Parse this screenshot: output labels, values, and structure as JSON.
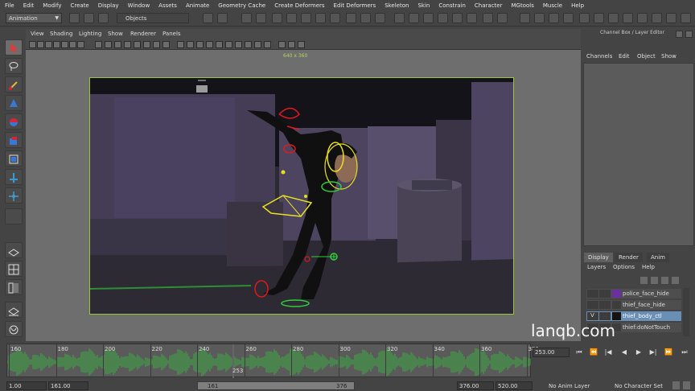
{
  "menubar": [
    "File",
    "Edit",
    "Modify",
    "Create",
    "Display",
    "Window",
    "Assets",
    "Animate",
    "Geometry Cache",
    "Create Deformers",
    "Edit Deformers",
    "Skeleton",
    "Skin",
    "Constrain",
    "Character",
    "MGtools",
    "Muscle",
    "Help"
  ],
  "statusline": {
    "mode": "Animation",
    "selection_mask": "Objects"
  },
  "panel_menu": [
    "View",
    "Shading",
    "Lighting",
    "Show",
    "Renderer",
    "Panels"
  ],
  "viewport": {
    "resolution": "640 x 360"
  },
  "channel_box": {
    "title": "Channel Box / Layer Editor",
    "menu": [
      "Channels",
      "Edit",
      "Object",
      "Show"
    ]
  },
  "layer_editor": {
    "tabs": [
      "Display",
      "Render",
      "Anim"
    ],
    "menu": [
      "Layers",
      "Options",
      "Help"
    ],
    "layers": [
      {
        "name": "police_face_hide",
        "color": "#6c2fa0",
        "visible": "",
        "selected": false
      },
      {
        "name": "thief_face_hide",
        "color": "#3d3d3d",
        "visible": "",
        "selected": false
      },
      {
        "name": "thief_body_ctl",
        "color": "#141414",
        "visible": "V",
        "selected": true
      },
      {
        "name": "thief:doNotTouch",
        "color": "#3d3d3d",
        "visible": "",
        "selected": false
      }
    ]
  },
  "timeline": {
    "ticks": [
      "160",
      "180",
      "200",
      "220",
      "240",
      "260",
      "280",
      "300",
      "320",
      "340",
      "360",
      "380"
    ],
    "current_frame_label": "253",
    "current_frame_field": "253.00"
  },
  "range": {
    "start": "1.00",
    "playback_start": "161.00",
    "range_start": "161",
    "range_end": "376",
    "playback_end": "376.00",
    "end": "520.00",
    "anim_layer": "No Anim Layer",
    "character_set": "No Character Set"
  },
  "watermark": "lanqb.com",
  "colors": {
    "rig_red": "#e01a1a",
    "rig_yellow": "#e8e020",
    "rig_green": "#2fcf3a",
    "gate_green": "#9ac43c",
    "selection_blue": "#6a8fb7"
  }
}
